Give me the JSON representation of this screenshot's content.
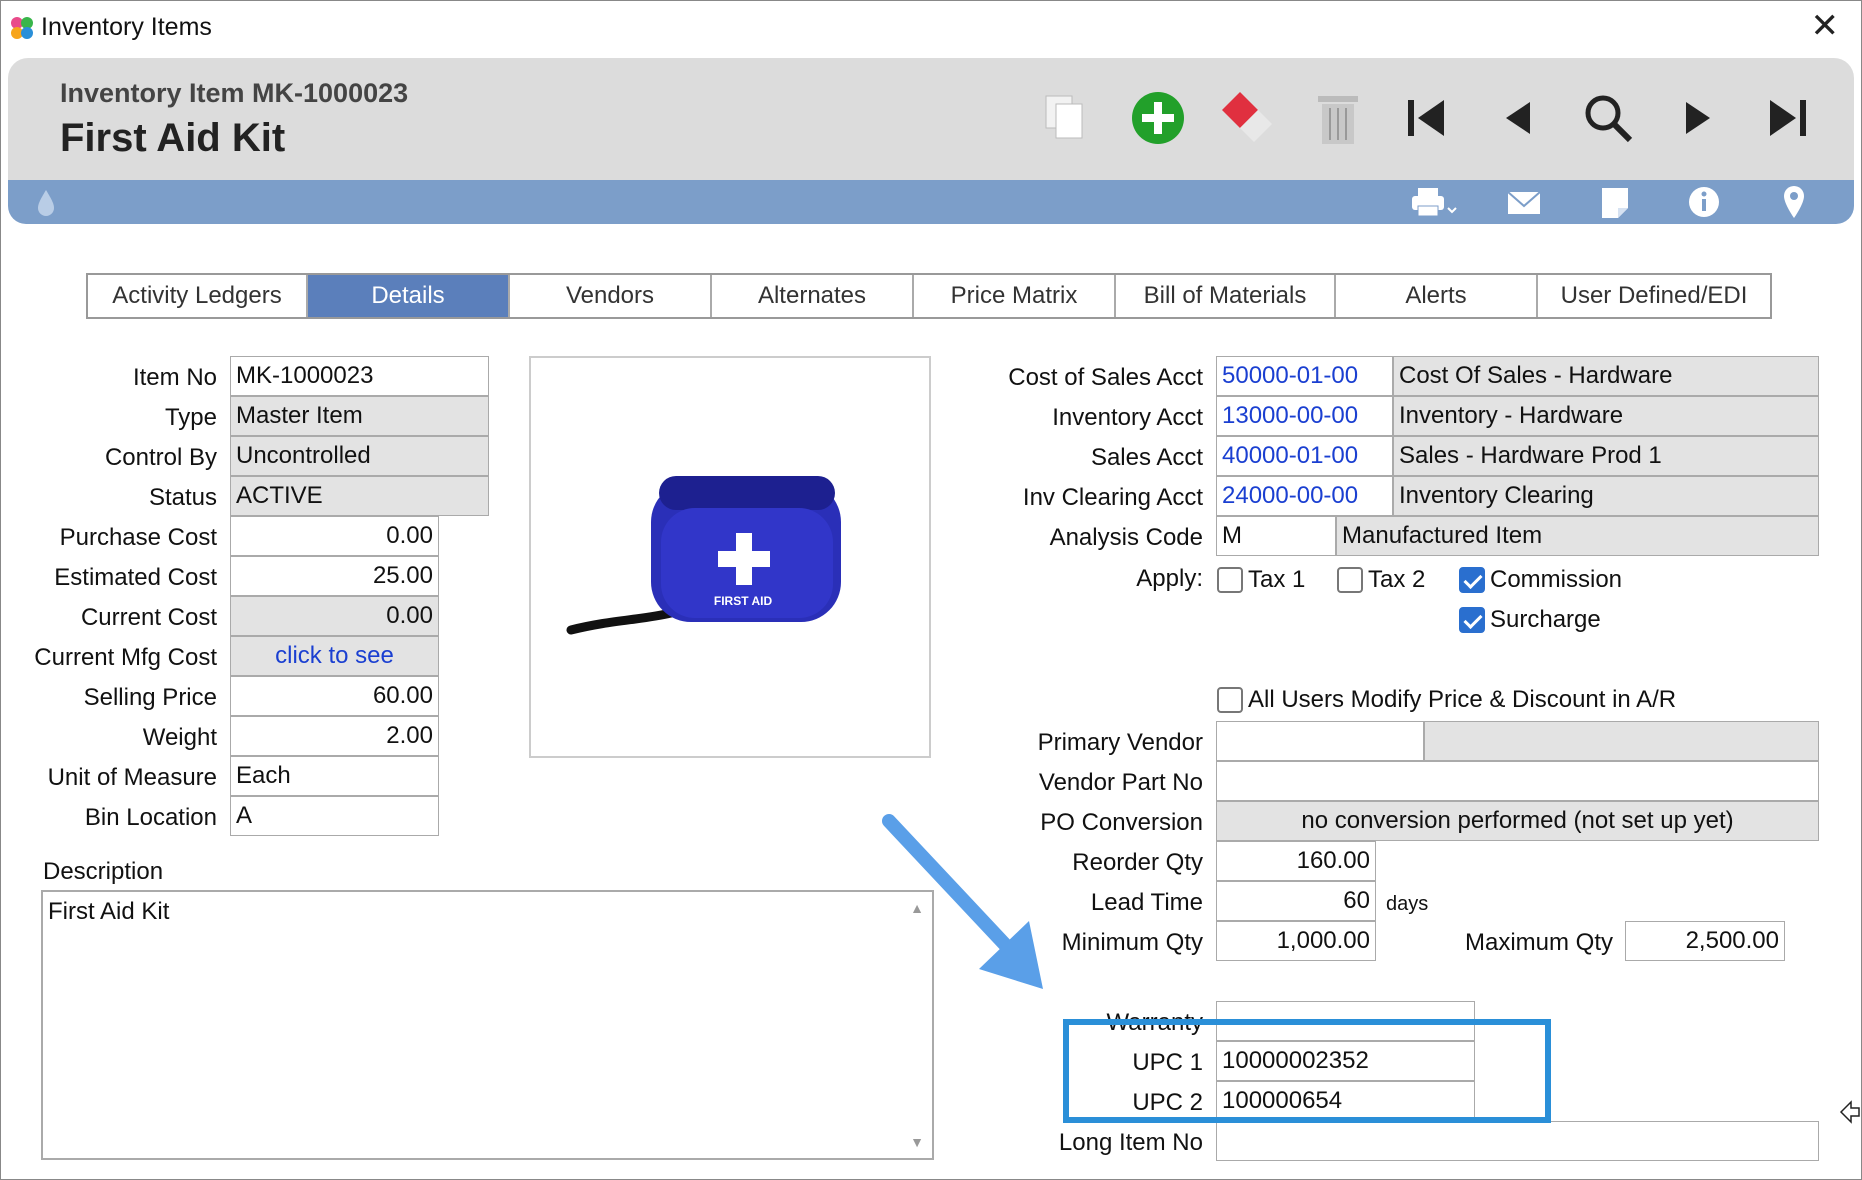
{
  "window": {
    "title": "Inventory Items"
  },
  "header": {
    "subtitle": "Inventory Item MK-1000023",
    "title": "First Aid Kit"
  },
  "toolbar": {
    "icons": [
      "copy-icon",
      "add-icon",
      "erase-icon",
      "delete-icon",
      "first-record-icon",
      "previous-record-icon",
      "search-icon",
      "next-record-icon",
      "last-record-icon"
    ]
  },
  "subtoolbar": {
    "icons": [
      "drop-icon",
      "print-icon",
      "email-icon",
      "note-icon",
      "info-icon",
      "location-icon"
    ]
  },
  "tabs": [
    {
      "label": "Activity Ledgers"
    },
    {
      "label": "Details"
    },
    {
      "label": "Vendors"
    },
    {
      "label": "Alternates"
    },
    {
      "label": "Price Matrix"
    },
    {
      "label": "Bill of Materials"
    },
    {
      "label": "Alerts"
    },
    {
      "label": "User Defined/EDI"
    }
  ],
  "active_tab": "Details",
  "left": {
    "item_no": {
      "label": "Item No",
      "value": "MK-1000023"
    },
    "type": {
      "label": "Type",
      "value": "Master Item"
    },
    "control_by": {
      "label": "Control By",
      "value": "Uncontrolled"
    },
    "status": {
      "label": "Status",
      "value": "ACTIVE"
    },
    "purchase_cost": {
      "label": "Purchase Cost",
      "value": "0.00"
    },
    "estimated_cost": {
      "label": "Estimated Cost",
      "value": "25.00"
    },
    "current_cost": {
      "label": "Current Cost",
      "value": "0.00"
    },
    "current_mfg_cost": {
      "label": "Current Mfg Cost",
      "value": "click to see"
    },
    "selling_price": {
      "label": "Selling Price",
      "value": "60.00"
    },
    "weight": {
      "label": "Weight",
      "value": "2.00"
    },
    "unit_of_measure": {
      "label": "Unit of Measure",
      "value": "Each"
    },
    "bin_location": {
      "label": "Bin Location",
      "value": "A"
    }
  },
  "description": {
    "label": "Description",
    "value": "First Aid Kit"
  },
  "image": {
    "caption": "FIRST AID"
  },
  "right": {
    "cost_of_sales_acct": {
      "label": "Cost of Sales Acct",
      "code": "50000-01-00",
      "name": "Cost Of Sales - Hardware"
    },
    "inventory_acct": {
      "label": "Inventory Acct",
      "code": "13000-00-00",
      "name": "Inventory - Hardware"
    },
    "sales_acct": {
      "label": "Sales Acct",
      "code": "40000-01-00",
      "name": "Sales - Hardware Prod 1"
    },
    "inv_clearing_acct": {
      "label": "Inv Clearing Acct",
      "code": "24000-00-00",
      "name": "Inventory Clearing"
    },
    "analysis_code": {
      "label": "Analysis Code",
      "code": "M",
      "name": "Manufactured Item"
    },
    "apply": {
      "label": "Apply:",
      "tax1": {
        "label": "Tax 1",
        "checked": false
      },
      "tax2": {
        "label": "Tax 2",
        "checked": false
      },
      "commission": {
        "label": "Commission",
        "checked": true
      },
      "surcharge": {
        "label": "Surcharge",
        "checked": true
      }
    },
    "all_users_modify": {
      "label": "All Users Modify Price & Discount in A/R",
      "checked": false
    },
    "primary_vendor": {
      "label": "Primary Vendor",
      "value": "",
      "name": ""
    },
    "vendor_part_no": {
      "label": "Vendor Part No",
      "value": ""
    },
    "po_conversion": {
      "label": "PO Conversion",
      "value": "no conversion performed (not set up yet)"
    },
    "reorder_qty": {
      "label": "Reorder Qty",
      "value": "160.00"
    },
    "lead_time": {
      "label": "Lead Time",
      "value": "60",
      "unit": "days"
    },
    "minimum_qty": {
      "label": "Minimum Qty",
      "value": "1,000.00"
    },
    "maximum_qty": {
      "label": "Maximum Qty",
      "value": "2,500.00"
    },
    "warranty": {
      "label": "Warranty",
      "value": ""
    },
    "upc1": {
      "label": "UPC 1",
      "value": "10000002352"
    },
    "upc2": {
      "label": "UPC 2",
      "value": "100000654"
    },
    "long_item_no": {
      "label": "Long Item No",
      "value": ""
    }
  },
  "colors": {
    "accent": "#5b7fbb",
    "subbar": "#7c9ec9",
    "highlight": "#2a8fd8",
    "link": "#1a3fd1",
    "add": "#22a02a"
  }
}
